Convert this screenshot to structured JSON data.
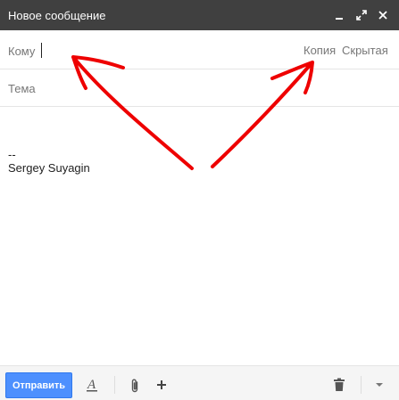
{
  "window": {
    "title": "Новое сообщение",
    "controls": [
      "minimize-icon",
      "expand-icon",
      "close-icon"
    ],
    "titlebar_color": "#404040"
  },
  "recipients": {
    "to_label": "Кому",
    "to_value": "",
    "cc_label": "Копия",
    "bcc_label": "Скрытая"
  },
  "subject": {
    "placeholder": "Тема",
    "value": ""
  },
  "body": {
    "signature_separator": "--",
    "signature_name": "Sergey Suyagin"
  },
  "toolbar": {
    "send_label": "Отправить",
    "send_color": "#4d90fe",
    "icons": [
      "format-text-icon",
      "attach-file-icon",
      "more-options-plus-icon",
      "trash-icon",
      "dropdown-arrow-icon"
    ]
  },
  "annotation": {
    "stroke_color": "#ee0000",
    "arrows": [
      "arrow-to-recipient-field",
      "arrow-to-cc-bcc-links"
    ]
  }
}
